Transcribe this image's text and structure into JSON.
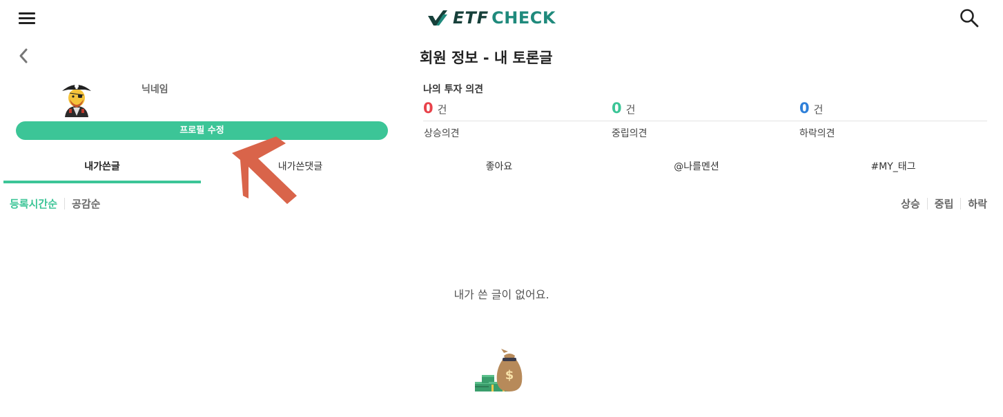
{
  "header": {
    "logo_etf": "ETF",
    "logo_check": "CHECK"
  },
  "page": {
    "title": "회원 정보 - 내 토론글"
  },
  "profile": {
    "nickname": "닉네임",
    "edit_button": "프로필 수정"
  },
  "opinions": {
    "label": "나의 투자 의견",
    "unit": "건",
    "items": [
      {
        "count": "0",
        "caption": "상승의견",
        "color": "#e8424a"
      },
      {
        "count": "0",
        "caption": "중립의견",
        "color": "#3cc597"
      },
      {
        "count": "0",
        "caption": "하락의견",
        "color": "#2f80d9"
      }
    ]
  },
  "tabs": [
    {
      "label": "내가쓴글",
      "active": true
    },
    {
      "label": "내가쓴댓글",
      "active": false
    },
    {
      "label": "좋아요",
      "active": false
    },
    {
      "label": "@나를멘션",
      "active": false
    },
    {
      "label": "#MY_태그",
      "active": false
    }
  ],
  "sort": {
    "left": [
      "등록시간순",
      "공감순"
    ],
    "right": [
      "상승",
      "중립",
      "하락"
    ]
  },
  "empty": {
    "message": "내가 쓴 글이 없어요."
  },
  "icons": {
    "menu": "menu-icon",
    "search": "search-icon",
    "back": "chevron-left-icon",
    "avatar": "pirate-avatar-icon",
    "arrow": "arrow-pointer-icon",
    "empty": "money-bag-icon"
  },
  "colors": {
    "accent": "#3cc597",
    "up": "#e8424a",
    "neutral": "#3cc597",
    "down": "#2f80d9",
    "arrow": "#d9644a"
  }
}
